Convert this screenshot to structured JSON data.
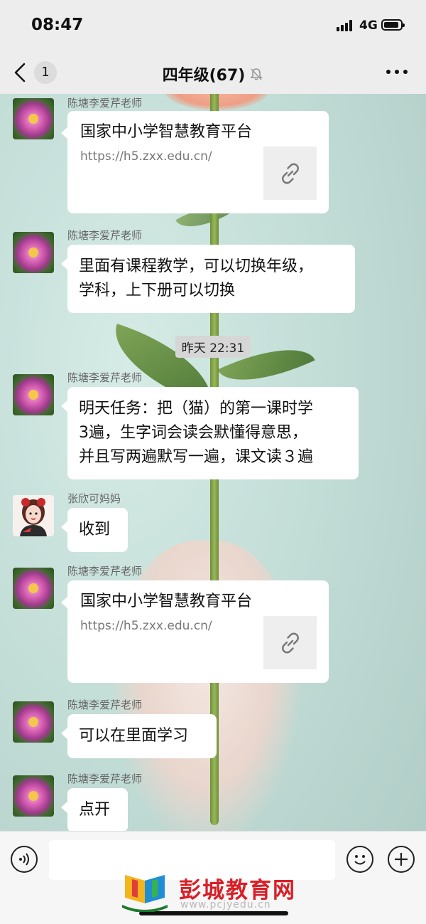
{
  "status_bar": {
    "time": "08:47",
    "network": "4G",
    "icons": [
      "signal-icon",
      "battery-icon"
    ]
  },
  "nav": {
    "back_count": "1",
    "title": "四年级(67)",
    "icons": [
      "back-chevron-icon",
      "mute-bell-icon",
      "more-icon"
    ]
  },
  "messages": [
    {
      "type": "link",
      "sender": "陈塘李爱芹老师",
      "title": "国家中小学智慧教育平台",
      "url": "https://h5.zxx.edu.cn/",
      "thumb_icon": "link-icon",
      "avatar": "peony-avatar"
    },
    {
      "type": "text",
      "sender": "陈塘李爱芹老师",
      "lines": [
        "里面有课程教学，可以切换年级，",
        "学科，上下册可以切换"
      ],
      "avatar": "peony-avatar"
    },
    {
      "type": "time",
      "text": "昨天 22:31"
    },
    {
      "type": "text",
      "sender": "陈塘李爱芹老师",
      "lines": [
        "明天任务：把（猫）的第一课时学",
        "3遍，生字词会读会默懂得意思，",
        "并且写两遍默写一遍，课文读３遍"
      ],
      "avatar": "peony-avatar"
    },
    {
      "type": "text",
      "sender": "张欣可妈妈",
      "lines": [
        "收到"
      ],
      "avatar": "girl-avatar"
    },
    {
      "type": "link",
      "sender": "陈塘李爱芹老师",
      "title": "国家中小学智慧教育平台",
      "url": "https://h5.zxx.edu.cn/",
      "thumb_icon": "link-icon",
      "avatar": "peony-avatar"
    },
    {
      "type": "text",
      "sender": "陈塘李爱芹老师",
      "lines": [
        "可以在里面学习"
      ],
      "avatar": "peony-avatar"
    },
    {
      "type": "text",
      "sender": "陈塘李爱芹老师",
      "lines": [
        "点开"
      ],
      "avatar": "peony-avatar"
    }
  ],
  "input_bar": {
    "placeholder": "",
    "icons": [
      "voice-icon",
      "emoji-icon",
      "plus-icon"
    ]
  },
  "watermark": {
    "text": "彭城教育网",
    "url": "www.pcjyedu.cn"
  },
  "colors": {
    "bubble": "#ffffff",
    "header_bg": "#ededed",
    "watermark_red": "#d81f26"
  }
}
